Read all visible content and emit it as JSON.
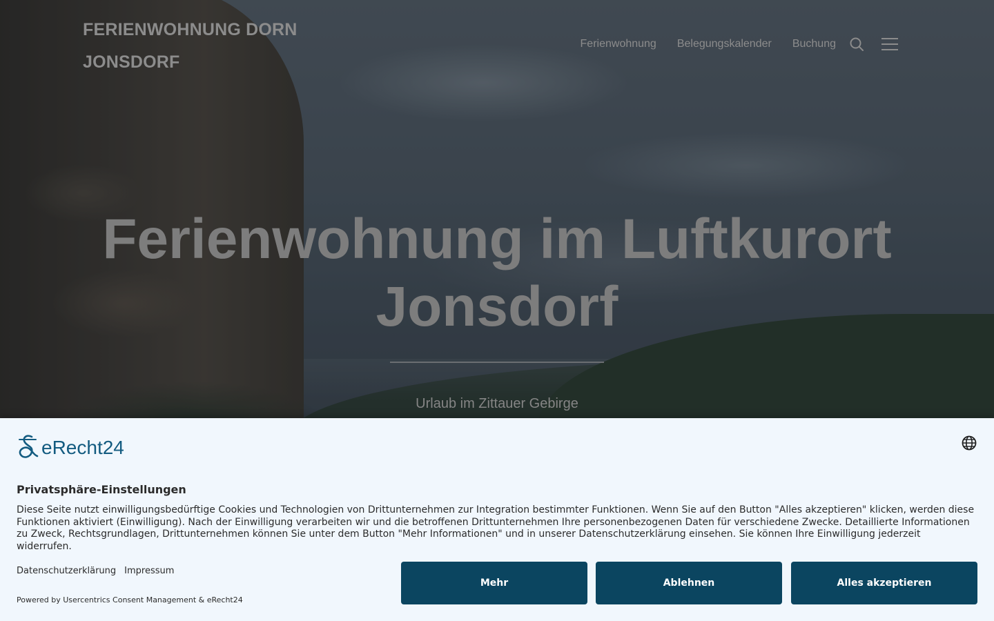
{
  "header": {
    "site_title": "FERIENWOHNUNG DORN JONSDORF",
    "nav": [
      {
        "label": "Ferienwohnung"
      },
      {
        "label": "Belegungskalender"
      },
      {
        "label": "Buchung"
      }
    ],
    "icons": {
      "search": "search-icon",
      "menu": "menu-icon"
    }
  },
  "hero": {
    "title": "Ferienwohnung im Luftkurort Jonsdorf",
    "subtitle": "Urlaub im Zittauer Gebirge"
  },
  "consent": {
    "logo_text": "eRecht24",
    "heading": "Privatsphäre-Einstellungen",
    "description": "Diese Seite nutzt einwilligungsbedürftige Cookies und Technologien von Drittunternehmen zur Integration bestimmter Funktionen. Wenn Sie auf den Button \"Alles akzeptieren\" klicken, werden diese Funktionen aktiviert (Einwilligung). Nach der Einwilligung verarbeiten wir und die betroffenen Drittunternehmen Ihre personenbezogenen Daten für verschiedene Zwecke. Detaillierte Informationen zu Zweck, Rechtsgrundlagen, Drittunternehmen können Sie unter dem Button \"Mehr Informationen\" und in unserer Datenschutzerklärung einsehen. Sie können Ihre Einwilligung jederzeit widerrufen.",
    "links": [
      {
        "label": "Datenschutzerklärung"
      },
      {
        "label": "Impressum"
      }
    ],
    "powered_by": "Powered by Usercentrics Consent Management & eRecht24",
    "buttons": {
      "more": "Mehr",
      "deny": "Ablehnen",
      "accept": "Alles akzeptieren"
    },
    "colors": {
      "button_bg": "#0b4560",
      "banner_bg": "#f1f7fd",
      "brand": "#135b80"
    }
  }
}
